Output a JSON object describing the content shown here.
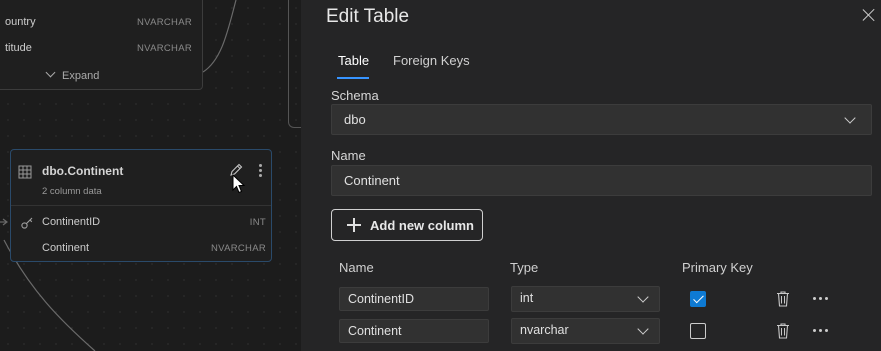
{
  "canvas": {
    "top_table": {
      "rows": [
        {
          "name": "ountry",
          "type": "NVARCHAR"
        },
        {
          "name": "titude",
          "type": "NVARCHAR"
        }
      ],
      "expand_label": "Expand"
    },
    "continent_table": {
      "title": "dbo.Continent",
      "subtitle": "2 column data",
      "columns": [
        {
          "name": "ContinentID",
          "type": "INT"
        },
        {
          "name": "Continent",
          "type": "NVARCHAR"
        }
      ]
    }
  },
  "panel": {
    "title": "Edit Table",
    "tabs": [
      {
        "label": "Table",
        "active": true
      },
      {
        "label": "Foreign Keys",
        "active": false
      }
    ],
    "schema": {
      "label": "Schema",
      "value": "dbo"
    },
    "name": {
      "label": "Name",
      "value": "Continent"
    },
    "add_column_label": "Add new column",
    "grid": {
      "headers": {
        "name": "Name",
        "type": "Type",
        "primary_key": "Primary Key"
      },
      "rows": [
        {
          "name": "ContinentID",
          "type": "int",
          "primary_key": true
        },
        {
          "name": "Continent",
          "type": "nvarchar",
          "primary_key": false
        }
      ]
    }
  },
  "colors": {
    "accent": "#3794ff",
    "checkbox": "#0e7ad3",
    "panel_bg": "#252526",
    "canvas_bg": "#1c1c1c"
  }
}
